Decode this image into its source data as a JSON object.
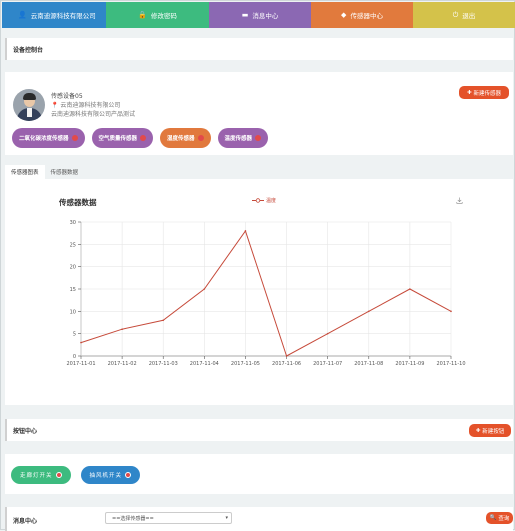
{
  "nav": [
    {
      "label": "云南迪源科技有限公司",
      "icon": "user-icon",
      "color": "#2f86c9"
    },
    {
      "label": "修改密码",
      "icon": "lock-icon",
      "color": "#3dbb7f"
    },
    {
      "label": "消息中心",
      "icon": "message-icon",
      "color": "#8b68b3"
    },
    {
      "label": "传感器中心",
      "icon": "tag-icon",
      "color": "#e17a3d"
    },
    {
      "label": "退出",
      "icon": "power-icon",
      "color": "#d4c24a"
    }
  ],
  "console": {
    "title": "设备控制台"
  },
  "device": {
    "name": "传感设备05",
    "company": "云南迪源科技有限公司",
    "description": "云南迪源科技有限公司产品测试",
    "new_sensor_label": "新建传感器",
    "sensors": [
      {
        "label": "二氧化碳浓度传感器",
        "color": "#9a62ad"
      },
      {
        "label": "空气质量传感器",
        "color": "#9a62ad"
      },
      {
        "label": "湿度传感器",
        "color": "#e1793d"
      },
      {
        "label": "温度传感器",
        "color": "#9a62ad"
      }
    ]
  },
  "tabs": [
    {
      "label": "传感器图表",
      "active": true
    },
    {
      "label": "传感器数据",
      "active": false
    }
  ],
  "chart_data": {
    "type": "line",
    "title": "传感器数据",
    "categories": [
      "2017-11-01",
      "2017-11-02",
      "2017-11-03",
      "2017-11-04",
      "2017-11-05",
      "2017-11-06",
      "2017-11-07",
      "2017-11-08",
      "2017-11-09",
      "2017-11-10"
    ],
    "series": [
      {
        "name": "温度",
        "values": [
          3,
          6,
          8,
          15,
          28,
          0,
          5,
          10,
          15,
          10
        ],
        "color": "#c64a3a"
      }
    ],
    "ylim": [
      0,
      30
    ],
    "yticks": [
      0,
      5,
      10,
      15,
      20,
      25,
      30
    ],
    "grid": true,
    "legend": "top"
  },
  "button_center": {
    "title": "按钮中心",
    "new_button_label": "新建按钮"
  },
  "switches": [
    {
      "label": "走廊灯开关",
      "color": "#3dbb7f"
    },
    {
      "label": "抽风机开关",
      "color": "#2f86c9"
    }
  ],
  "message_center": {
    "title": "消息中心",
    "select_value": "==选择传感器==",
    "query_label": "查询"
  }
}
